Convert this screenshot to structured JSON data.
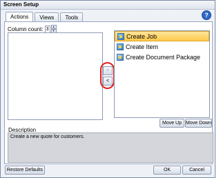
{
  "window": {
    "title": "Screen Setup"
  },
  "tabs": [
    {
      "label": "Actions",
      "active": true
    },
    {
      "label": "Views",
      "active": false
    },
    {
      "label": "Tools",
      "active": false
    }
  ],
  "help": {
    "icon": "help-icon",
    "glyph": "?"
  },
  "column_count": {
    "label": "Column count:",
    "value": "3"
  },
  "move_buttons": {
    "add_label": ">",
    "remove_label": "<"
  },
  "selected_list": {
    "items": [
      {
        "label": "Create Job",
        "icon": "create-job-icon",
        "selected": true
      },
      {
        "label": "Create Item",
        "icon": "create-item-icon",
        "selected": false
      },
      {
        "label": "Create Document Package",
        "icon": "document-package-icon",
        "selected": false
      }
    ]
  },
  "order_buttons": {
    "move_up": "Move Up",
    "move_down": "Move Down"
  },
  "description": {
    "label": "Description",
    "text": "Create a new quote for customers."
  },
  "footer": {
    "restore_defaults": "Restore Defaults",
    "ok": "OK",
    "cancel": "Cancel"
  },
  "colors": {
    "highlight_ring": "#e31818",
    "selection": "#ffc94a",
    "help_icon": "#2e67c8"
  }
}
